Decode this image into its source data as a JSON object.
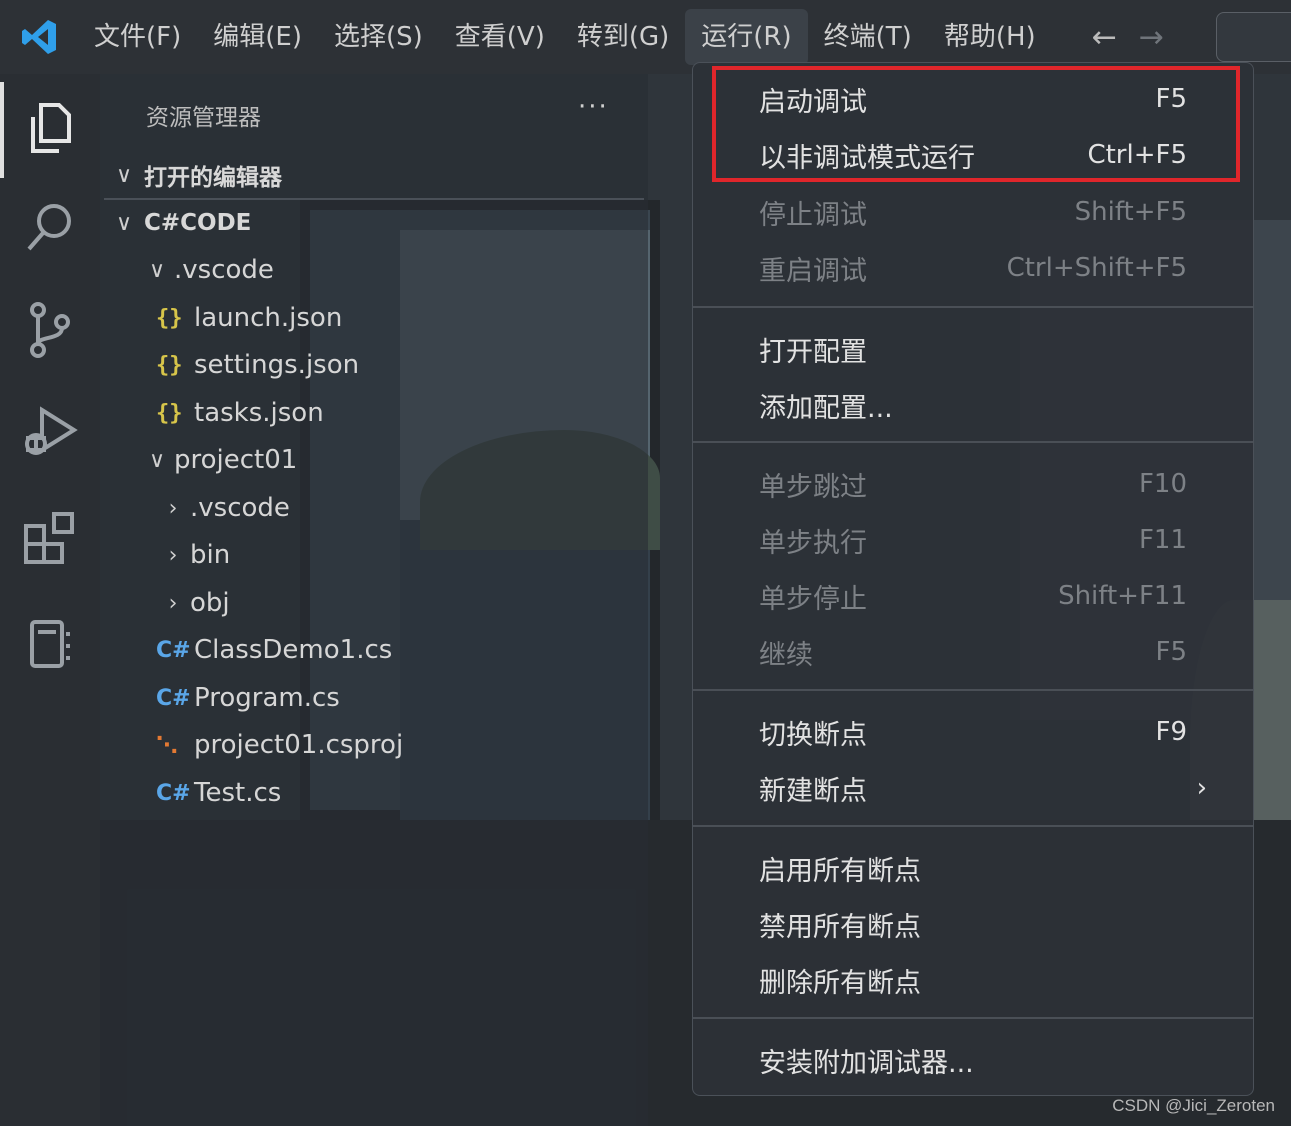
{
  "menubar": {
    "items": [
      "文件(F)",
      "编辑(E)",
      "选择(S)",
      "查看(V)",
      "转到(G)",
      "运行(R)",
      "终端(T)",
      "帮助(H)"
    ],
    "active": "运行(R)",
    "back_icon": "arrow-left-icon",
    "forward_icon": "arrow-right-icon"
  },
  "activitybar": {
    "icons": [
      "explorer-icon",
      "search-icon",
      "source-control-icon",
      "run-debug-icon",
      "extensions-icon",
      "notebook-icon"
    ]
  },
  "explorer": {
    "title": "资源管理器",
    "more": "···",
    "open_editors": "打开的编辑器",
    "workspace": "C#CODE",
    "tree": [
      {
        "label": ".vscode",
        "type": "folder-open"
      },
      {
        "label": "launch.json",
        "type": "json"
      },
      {
        "label": "settings.json",
        "type": "json"
      },
      {
        "label": "tasks.json",
        "type": "json"
      },
      {
        "label": "project01",
        "type": "folder-open"
      },
      {
        "label": ".vscode",
        "type": "folder"
      },
      {
        "label": "bin",
        "type": "folder"
      },
      {
        "label": "obj",
        "type": "folder"
      },
      {
        "label": "ClassDemo1.cs",
        "type": "cs"
      },
      {
        "label": "Program.cs",
        "type": "cs"
      },
      {
        "label": "project01.csproj",
        "type": "csproj"
      },
      {
        "label": "Test.cs",
        "type": "cs"
      }
    ]
  },
  "run_menu": {
    "items": [
      {
        "label": "启动调试",
        "shortcut": "F5",
        "disabled": false
      },
      {
        "label": "以非调试模式运行",
        "shortcut": "Ctrl+F5",
        "disabled": false
      },
      {
        "label": "停止调试",
        "shortcut": "Shift+F5",
        "disabled": true
      },
      {
        "label": "重启调试",
        "shortcut": "Ctrl+Shift+F5",
        "disabled": true
      },
      {
        "label": "打开配置",
        "shortcut": "",
        "disabled": false
      },
      {
        "label": "添加配置...",
        "shortcut": "",
        "disabled": false
      },
      {
        "label": "单步跳过",
        "shortcut": "F10",
        "disabled": true
      },
      {
        "label": "单步执行",
        "shortcut": "F11",
        "disabled": true
      },
      {
        "label": "单步停止",
        "shortcut": "Shift+F11",
        "disabled": true
      },
      {
        "label": "继续",
        "shortcut": "F5",
        "disabled": true
      },
      {
        "label": "切换断点",
        "shortcut": "F9",
        "disabled": false
      },
      {
        "label": "新建断点",
        "shortcut": "",
        "disabled": false,
        "submenu_icon": "chevron-right-icon"
      },
      {
        "label": "启用所有断点",
        "shortcut": "",
        "disabled": false
      },
      {
        "label": "禁用所有断点",
        "shortcut": "",
        "disabled": false
      },
      {
        "label": "删除所有断点",
        "shortcut": "",
        "disabled": false
      },
      {
        "label": "安装附加调试器...",
        "shortcut": "",
        "disabled": false
      }
    ],
    "highlight_color": "#e0262b"
  },
  "watermark": "CSDN @Jici_Zeroten"
}
